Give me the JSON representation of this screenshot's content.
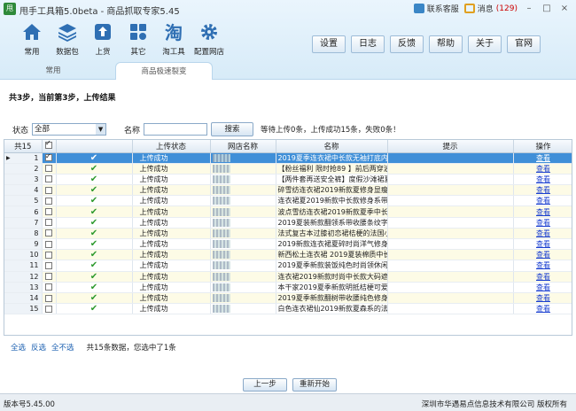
{
  "app": {
    "logo_text": "甩",
    "title": "甩手工具箱5.0beta - 商品抓取专家5.45",
    "support_label": "联系客服",
    "message_label": "消息",
    "message_count": "(129)"
  },
  "toolbar": [
    {
      "label": "常用",
      "icon": "home-icon"
    },
    {
      "label": "数据包",
      "icon": "layers-icon"
    },
    {
      "label": "上货",
      "icon": "upload-icon"
    },
    {
      "label": "其它",
      "icon": "grid-icon"
    },
    {
      "label": "淘工具",
      "icon": "tao-icon"
    },
    {
      "label": "配置网店",
      "icon": "gear-icon"
    }
  ],
  "top_buttons": [
    "设置",
    "日志",
    "反馈",
    "帮助",
    "关于",
    "官网"
  ],
  "tabs": {
    "common": "常用",
    "active": "商品极速裂变"
  },
  "step_title": "共3步，当前第3步，上传结果",
  "filter": {
    "status_label": "状态",
    "status_value": "全部",
    "name_label": "名称",
    "name_value": "",
    "search_label": "搜索",
    "summary": "等待上传0条，上传成功15条，失败0条！"
  },
  "table": {
    "total_header": "共15",
    "headers": [
      "上传状态",
      "网店名称",
      "名称",
      "提示",
      "操作"
    ],
    "rows": [
      {
        "no": "1",
        "checked": true,
        "status": "上传成功",
        "name": "2019夏季连衣裙中长款无袖打底内衬…",
        "op": "查看"
      },
      {
        "no": "2",
        "checked": false,
        "status": "上传成功",
        "name": "【粉丝福利 限时抢89 】前后两穿波…",
        "op": "查看"
      },
      {
        "no": "3",
        "checked": false,
        "status": "上传成功",
        "name": "【两件套再送安全裤】度假沙滩裙夏…",
        "op": "查看"
      },
      {
        "no": "4",
        "checked": false,
        "status": "上传成功",
        "name": "碎雪纺连衣裙2019新款夏修身显瘦大…",
        "op": "查看"
      },
      {
        "no": "5",
        "checked": false,
        "status": "上传成功",
        "name": "连衣裙夏2019新款中长款修身系带无袖…",
        "op": "查看"
      },
      {
        "no": "6",
        "checked": false,
        "status": "上传成功",
        "name": "波点雪纺连衣裙2019新款夏季中长款…",
        "op": "查看"
      },
      {
        "no": "7",
        "checked": false,
        "status": "上传成功",
        "name": "2019夏装新款翻领系带收腰条纹字母…",
        "op": "查看"
      },
      {
        "no": "8",
        "checked": false,
        "status": "上传成功",
        "name": "法式复古本过膝初恋裙桔梗的法国小众…",
        "op": "查看"
      },
      {
        "no": "9",
        "checked": false,
        "status": "上传成功",
        "name": "2019新款连衣裙夏碎时尚洋气修身…",
        "op": "查看"
      },
      {
        "no": "10",
        "checked": false,
        "status": "上传成功",
        "name": "新西松土连衣裙 2019夏装棉质中长…",
        "op": "查看"
      },
      {
        "no": "11",
        "checked": false,
        "status": "上传成功",
        "name": "2019夏季新款装饭纯色时尚领休闲拍…",
        "op": "查看"
      },
      {
        "no": "12",
        "checked": false,
        "status": "上传成功",
        "name": "连衣裙2019新款时尚中长款大码遮肉…",
        "op": "查看"
      },
      {
        "no": "13",
        "checked": false,
        "status": "上传成功",
        "name": "本干家2019夏季新款明抵桔梗可爱另…",
        "op": "查看"
      },
      {
        "no": "14",
        "checked": false,
        "status": "上传成功",
        "name": "2019夏季新款翻树带收腰纯色修身显…",
        "op": "查看"
      },
      {
        "no": "15",
        "checked": false,
        "status": "上传成功",
        "name": "白色连衣裙仙2019新款夏森系的法国…",
        "op": "查看"
      }
    ]
  },
  "selection": {
    "select_all": "全选",
    "invert": "反选",
    "select_none": "全不选",
    "summary": "共15条数据，您选中了1条"
  },
  "nav": {
    "prev": "上一步",
    "restart": "重新开始"
  },
  "statusbar": {
    "version": "版本号5.45.00",
    "company": "深圳市华遇易点信息技术有限公司 版权所有"
  },
  "colors": {
    "accent": "#3f8fd8",
    "header_bg": "#dcedf9",
    "success": "#2e9a2e",
    "link": "#1a3fd0"
  }
}
